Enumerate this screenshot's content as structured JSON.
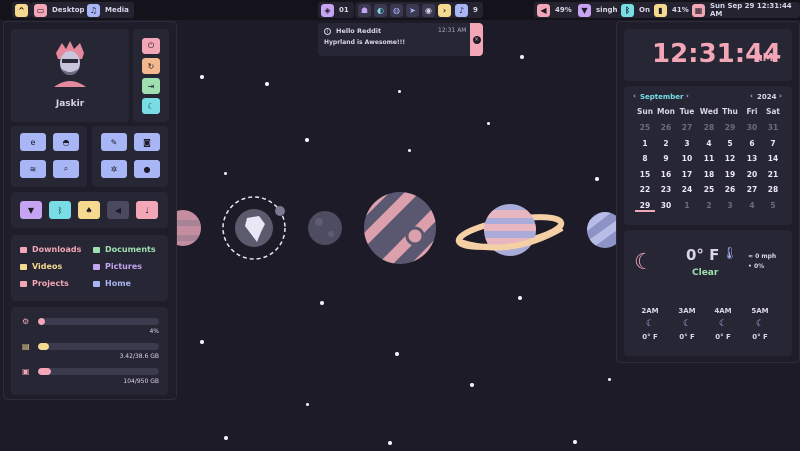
{
  "topbar": {
    "desktop_label": "Desktop",
    "media_label": "Media",
    "workspace_number": "01",
    "notif_count": "9",
    "volume": "49%",
    "network": "singh",
    "bluetooth": "On",
    "battery": "41%",
    "datetime": "Sun Sep 29  12:31:44 AM"
  },
  "profile": {
    "name": "Jaskir"
  },
  "folders": [
    {
      "label": "Downloads",
      "color": "#f2a6b6"
    },
    {
      "label": "Documents",
      "color": "#9fe0b1"
    },
    {
      "label": "Videos",
      "color": "#f5d98f"
    },
    {
      "label": "Pictures",
      "color": "#c6a4f2"
    },
    {
      "label": "Projects",
      "color": "#f2a6b6"
    },
    {
      "label": "Home",
      "color": "#a9b6f5"
    }
  ],
  "resources": {
    "cpu": {
      "label": "4%",
      "fraction": 0.04
    },
    "ram": {
      "label": "3.42/38.6 GB",
      "fraction": 0.09
    },
    "disk": {
      "label": "104/950 GB",
      "fraction": 0.11
    }
  },
  "notification": {
    "title": "Hello Reddit",
    "time": "12:31 AM",
    "body": "Hyprland is Awesome!!!"
  },
  "clock": {
    "time": "12:31:44",
    "ampm": "AM"
  },
  "calendar": {
    "month": "September",
    "year": "2024",
    "weekdays": [
      "Sun",
      "Mon",
      "Tue",
      "Wed",
      "Thu",
      "Fri",
      "Sat"
    ],
    "rows": [
      [
        "25",
        "26",
        "27",
        "28",
        "29",
        "30",
        "31"
      ],
      [
        "1",
        "2",
        "3",
        "4",
        "5",
        "6",
        "7"
      ],
      [
        "8",
        "9",
        "10",
        "11",
        "12",
        "13",
        "14"
      ],
      [
        "15",
        "16",
        "17",
        "18",
        "19",
        "20",
        "21"
      ],
      [
        "22",
        "23",
        "24",
        "25",
        "26",
        "27",
        "28"
      ],
      [
        "29",
        "30",
        "1",
        "2",
        "3",
        "4",
        "5"
      ]
    ],
    "today": "29"
  },
  "weather": {
    "temp": "0° F",
    "condition": "Clear",
    "wind": "0 mph",
    "precip": "0%",
    "hourly": [
      {
        "time": "2AM",
        "temp": "0° F"
      },
      {
        "time": "3AM",
        "temp": "0° F"
      },
      {
        "time": "4AM",
        "temp": "0° F"
      },
      {
        "time": "5AM",
        "temp": "0° F"
      }
    ]
  },
  "colors": {
    "accent_pink": "#f2a6b6",
    "accent_blue": "#a9b6f5",
    "accent_yellow": "#f5d98f",
    "accent_cyan": "#79dde5",
    "accent_green": "#9fe0b1",
    "background": "#1c1b27"
  }
}
